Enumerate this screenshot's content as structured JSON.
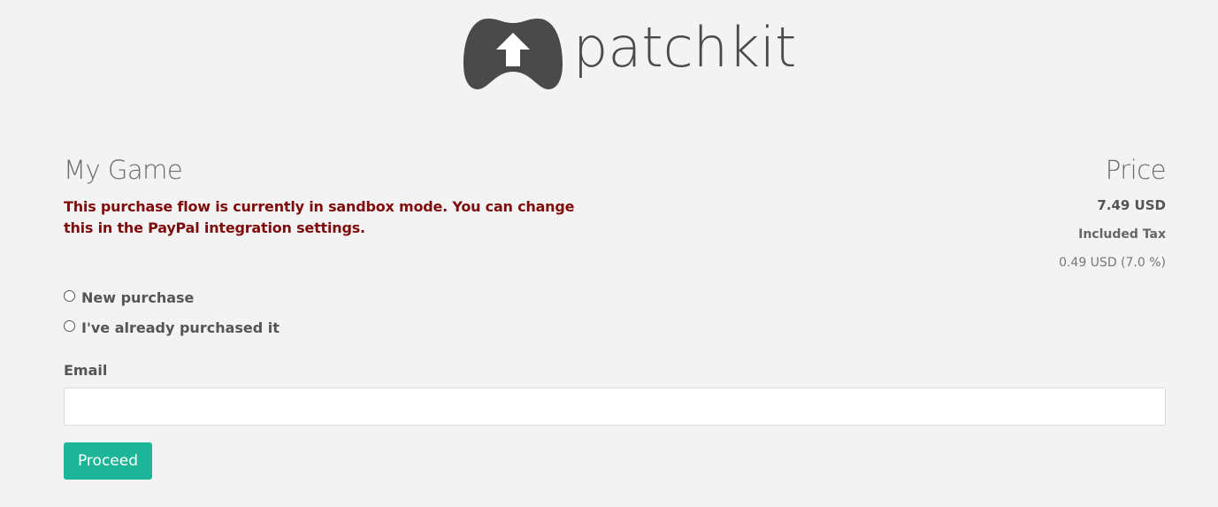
{
  "brand": {
    "logo_icon": "gamepad-upload-arrow-icon",
    "name": "patchkit",
    "color": "#4a4a4a"
  },
  "product": {
    "title": "My Game",
    "sandbox_notice": "This purchase flow is currently in sandbox mode. You can change this in the PayPal integration settings.",
    "notice_color": "#7e0c0c"
  },
  "pricing": {
    "title": "Price",
    "amount": "7.49 USD",
    "tax_label": "Included Tax",
    "tax_value": "0.49 USD (7.0 %)"
  },
  "purchase_options": [
    {
      "label": "New purchase",
      "selected": false
    },
    {
      "label": "I've already purchased it",
      "selected": false
    }
  ],
  "email": {
    "label": "Email",
    "value": "",
    "placeholder": ""
  },
  "actions": {
    "proceed_label": "Proceed",
    "proceed_color": "#1db597"
  }
}
